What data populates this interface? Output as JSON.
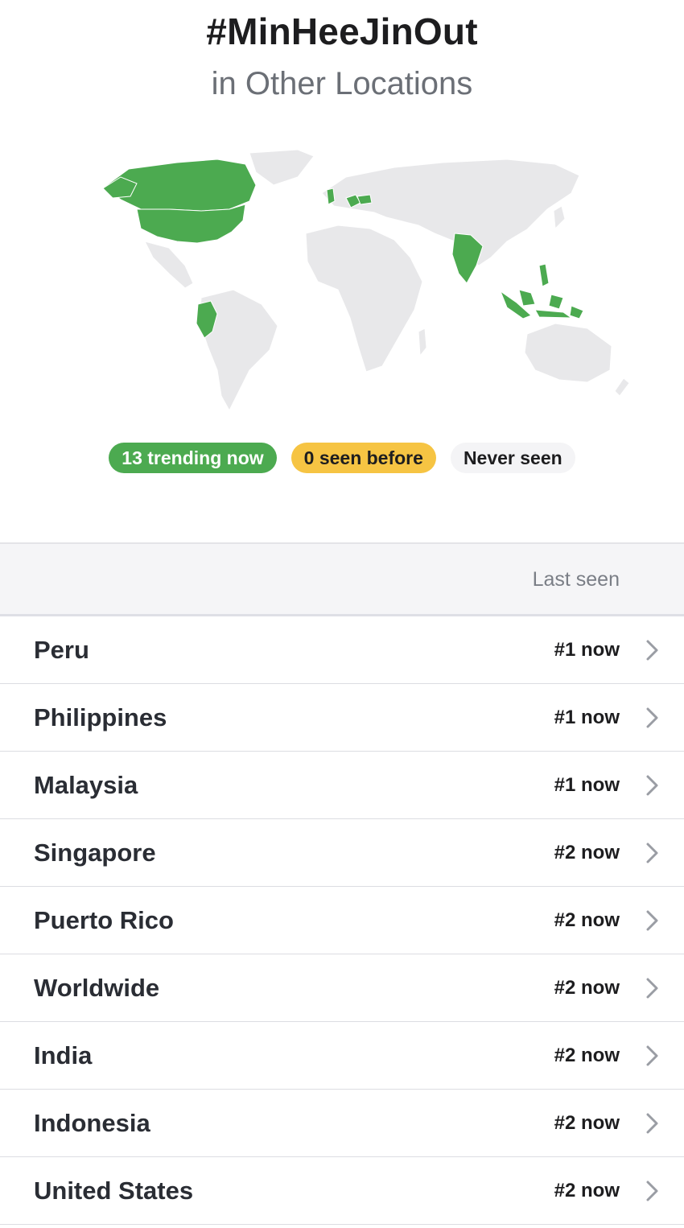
{
  "header": {
    "title": "#MinHeeJinOut",
    "subtitle": "in Other Locations"
  },
  "map": {
    "highlight_color": "#4caa50",
    "base_color": "#e8e8ea"
  },
  "legend": {
    "trending": "13 trending now",
    "seen_before": "0 seen before",
    "never_seen": "Never seen"
  },
  "table": {
    "last_seen_label": "Last seen",
    "rows": [
      {
        "name": "Peru",
        "rank": "#1 now"
      },
      {
        "name": "Philippines",
        "rank": "#1 now"
      },
      {
        "name": "Malaysia",
        "rank": "#1 now"
      },
      {
        "name": "Singapore",
        "rank": "#2 now"
      },
      {
        "name": "Puerto Rico",
        "rank": "#2 now"
      },
      {
        "name": "Worldwide",
        "rank": "#2 now"
      },
      {
        "name": "India",
        "rank": "#2 now"
      },
      {
        "name": "Indonesia",
        "rank": "#2 now"
      },
      {
        "name": "United States",
        "rank": "#2 now"
      }
    ]
  }
}
